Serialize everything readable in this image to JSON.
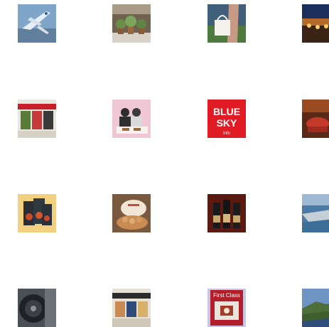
{
  "grid": {
    "thumbnails": [
      {
        "row": 0,
        "col": 0,
        "subject": "airplane",
        "icon": "airplane-thumbnail"
      },
      {
        "row": 0,
        "col": 1,
        "subject": "potted plants on shelf",
        "icon": "plants-thumbnail"
      },
      {
        "row": 0,
        "col": 2,
        "subject": "woman holding white tote bag",
        "icon": "tote-bag-thumbnail"
      },
      {
        "row": 0,
        "col": 3,
        "subject": "night building lights",
        "icon": "night-building-thumbnail"
      },
      {
        "row": 1,
        "col": 0,
        "subject": "shop storefront",
        "icon": "storefront-thumbnail"
      },
      {
        "row": 1,
        "col": 1,
        "subject": "people dining",
        "icon": "dining-thumbnail"
      },
      {
        "row": 1,
        "col": 2,
        "subject": "magazine cover",
        "icon": "blue-sky-cover-thumbnail",
        "text": {
          "line1": "BLUE",
          "line2": "SKY",
          "small": "Info"
        }
      },
      {
        "row": 1,
        "col": 3,
        "subject": "lounge chair interior",
        "icon": "lounge-thumbnail"
      },
      {
        "row": 2,
        "col": 0,
        "subject": "food packages",
        "icon": "food-packages-thumbnail"
      },
      {
        "row": 2,
        "col": 1,
        "subject": "pastry box",
        "icon": "pastry-box-thumbnail"
      },
      {
        "row": 2,
        "col": 2,
        "subject": "wine bottles",
        "icon": "wine-bottles-thumbnail"
      },
      {
        "row": 2,
        "col": 3,
        "subject": "aerial harbor view",
        "icon": "harbor-thumbnail"
      },
      {
        "row": 3,
        "col": 0,
        "subject": "jet engine",
        "icon": "jet-engine-thumbnail"
      },
      {
        "row": 3,
        "col": 1,
        "subject": "duty free shop",
        "icon": "duty-free-shop-thumbnail"
      },
      {
        "row": 3,
        "col": 2,
        "subject": "first class brochure",
        "icon": "first-class-brochure-thumbnail",
        "text": {
          "title": "First Class"
        }
      },
      {
        "row": 3,
        "col": 3,
        "subject": "coastal landscape",
        "icon": "coast-thumbnail"
      }
    ]
  }
}
